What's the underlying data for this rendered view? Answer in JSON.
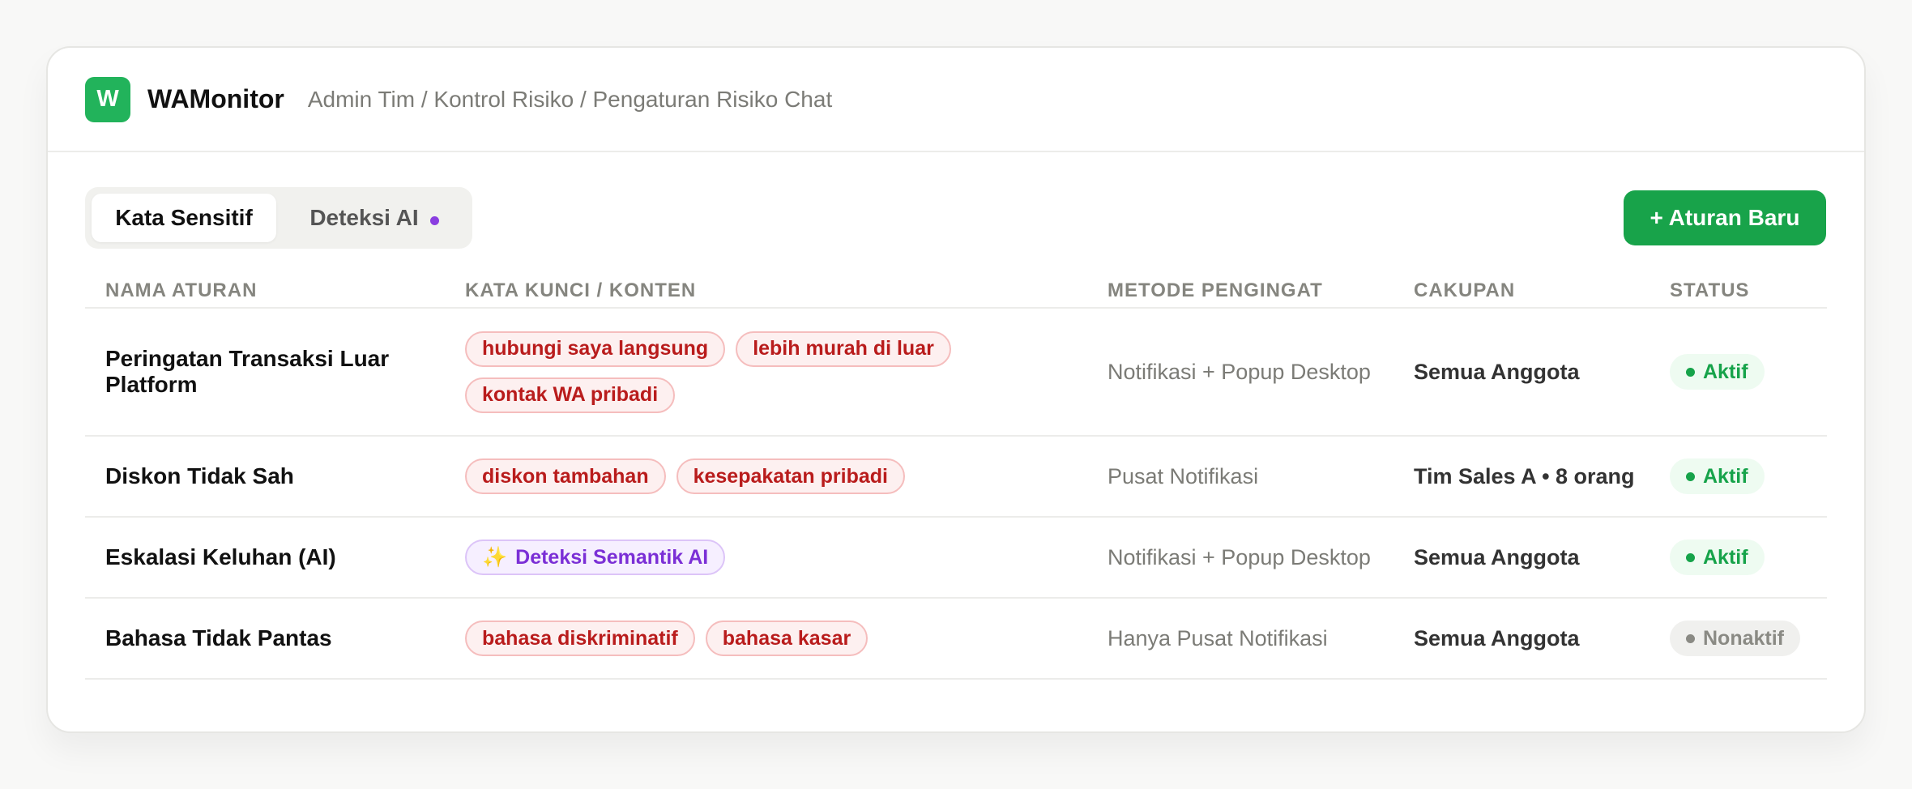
{
  "app": {
    "logo_letter": "W",
    "name": "WAMonitor"
  },
  "breadcrumb": "Admin Tim / Kontrol Risiko / Pengaturan Risiko Chat",
  "tabs": [
    {
      "label": "Kata Sensitif",
      "active": true
    },
    {
      "label": "Deteksi AI",
      "active": false,
      "indicator_color": "#8a3ee0"
    }
  ],
  "new_rule_button": "+ Aturan Baru",
  "columns": [
    "NAMA ATURAN",
    "KATA KUNCI / KONTEN",
    "METODE PENGINGAT",
    "CAKUPAN",
    "STATUS"
  ],
  "rules": [
    {
      "name": "Peringatan Transaksi Luar Platform",
      "keywords": [
        "hubungi saya langsung",
        "lebih murah di luar",
        "kontak WA pribadi"
      ],
      "method": "Notifikasi + Popup Desktop",
      "scope": "Semua Anggota",
      "status": "Aktif"
    },
    {
      "name": "Diskon Tidak Sah",
      "keywords": [
        "diskon tambahan",
        "kesepakatan pribadi"
      ],
      "method": "Pusat Notifikasi",
      "scope": "Tim Sales A • 8 orang",
      "status": "Aktif"
    },
    {
      "name": "Eskalasi Keluhan (AI)",
      "ai_chip": {
        "icon": "sparkles-icon",
        "glyph": "✨",
        "label": "Deteksi Semantik AI"
      },
      "method": "Notifikasi + Popup Desktop",
      "scope": "Semua Anggota",
      "status": "Aktif"
    },
    {
      "name": "Bahasa Tidak Pantas",
      "keywords": [
        "bahasa diskriminatif",
        "bahasa kasar"
      ],
      "method": "Hanya Pusat Notifikasi",
      "scope": "Semua Anggota",
      "status": "Nonaktif"
    }
  ],
  "colors": {
    "brand": "#22b35b",
    "primary_button": "#18a34a",
    "keyword_chip": "#b91c1c",
    "ai_chip": "#7b2fd6",
    "status_active": "#16a34a",
    "status_inactive": "#8a8a84"
  }
}
